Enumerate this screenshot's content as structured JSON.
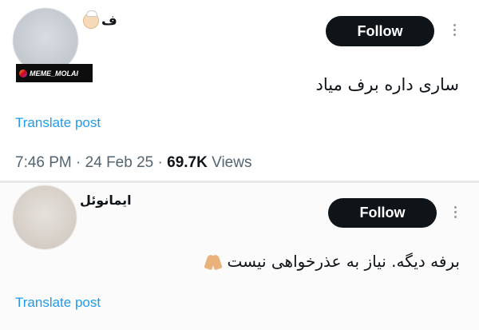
{
  "posts": [
    {
      "author_name": "ف",
      "author_emoji": "baby-angel-emoji",
      "watermark": "MEME_MOLAI",
      "follow_label": "Follow",
      "text": "ساری داره برف میاد",
      "translate_label": "Translate post",
      "time": "7:46 PM",
      "date": "24 Feb 25",
      "views_count": "69.7K",
      "views_label": "Views"
    },
    {
      "author_name": "ایمانوئل",
      "follow_label": "Follow",
      "text": "برفه دیگه. نیاز به عذرخواهی نیست",
      "text_emoji": "folded-hands-emoji",
      "translate_label": "Translate post"
    }
  ],
  "colors": {
    "follow_bg": "#0f1419",
    "link": "#1d9bf0",
    "muted": "#536471"
  }
}
